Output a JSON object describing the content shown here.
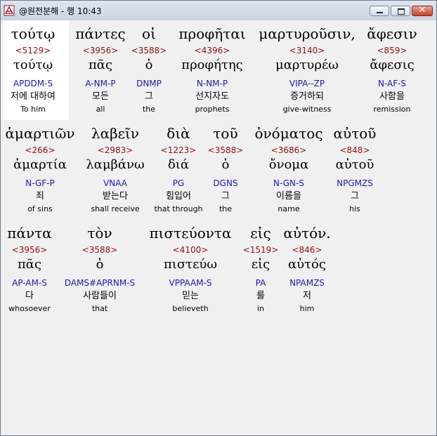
{
  "window": {
    "title": "@원전분해 - 행 10:43"
  },
  "verse": {
    "rows": [
      [
        {
          "greek": "τούτῳ",
          "strongs": "<5129>",
          "lemma": "τούτῳ",
          "parsing": "APDDM-S",
          "korean": "저에 대하여",
          "english": "To him",
          "selected": true
        },
        {
          "greek": "πάντες",
          "strongs": "<3956>",
          "lemma": "πᾶς",
          "parsing": "A-NM-P",
          "korean": "모든",
          "english": "all"
        },
        {
          "greek": "οἱ",
          "strongs": "<3588>",
          "lemma": "ὁ",
          "parsing": "DNMP",
          "korean": "그",
          "english": "the"
        },
        {
          "greek": "προφῆται",
          "strongs": "<4396>",
          "lemma": "προφήτης",
          "parsing": "N-NM-P",
          "korean": "선지자도",
          "english": "prophets"
        },
        {
          "greek": "μαρτυροῦσιν,",
          "strongs": "<3140>",
          "lemma": "μαρτυρέω",
          "parsing": "VIPA--ZP",
          "korean": "증거하되",
          "english": "give-witness"
        },
        {
          "greek": "ἄφεσιν",
          "strongs": "<859>",
          "lemma": "ἄφεσις",
          "parsing": "N-AF-S",
          "korean": "사함을",
          "english": "remission"
        }
      ],
      [
        {
          "greek": "ἁμαρτιῶν",
          "strongs": "<266>",
          "lemma": "ἁμαρτία",
          "parsing": "N-GF-P",
          "korean": "죄",
          "english": "of sins"
        },
        {
          "greek": "λαβεῖν",
          "strongs": "<2983>",
          "lemma": "λαμβάνω",
          "parsing": "VNAA",
          "korean": "받는다",
          "english": "shall receive"
        },
        {
          "greek": "διὰ",
          "strongs": "<1223>",
          "lemma": "διά",
          "parsing": "PG",
          "korean": "힘입어",
          "english": "that through"
        },
        {
          "greek": "τοῦ",
          "strongs": "<3588>",
          "lemma": "ὁ",
          "parsing": "DGNS",
          "korean": "그",
          "english": "the"
        },
        {
          "greek": "ὀνόματος",
          "strongs": "<3686>",
          "lemma": "ὄνομα",
          "parsing": "N-GN-S",
          "korean": "이름을",
          "english": "name"
        },
        {
          "greek": "αὐτοῦ",
          "strongs": "<848>",
          "lemma": "αὑτοῦ",
          "parsing": "NPGMZS",
          "korean": "그",
          "english": "his"
        }
      ],
      [
        {
          "greek": "πάντα",
          "strongs": "<3956>",
          "lemma": "πᾶς",
          "parsing": "AP-AM-S",
          "korean": "다",
          "english": "whosoever"
        },
        {
          "greek": "τὸν",
          "strongs": "<3588>",
          "lemma": "ὁ",
          "parsing": "DAMS#APRNM-S",
          "korean": "사람들이",
          "english": "that"
        },
        {
          "greek": "πιστεύοντα",
          "strongs": "<4100>",
          "lemma": "πιστεύω",
          "parsing": "VPPAAM-S",
          "korean": "믿는",
          "english": "believeth"
        },
        {
          "greek": "εἰς",
          "strongs": "<1519>",
          "lemma": "εἰς",
          "parsing": "PA",
          "korean": "를",
          "english": "in"
        },
        {
          "greek": "αὐτόν.",
          "strongs": "<846>",
          "lemma": "αὐτός",
          "parsing": "NPAMZS",
          "korean": "저",
          "english": "him"
        }
      ]
    ]
  }
}
